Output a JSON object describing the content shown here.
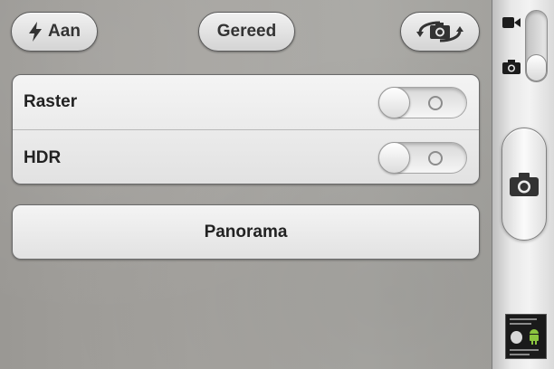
{
  "toolbar": {
    "flash_label": "Aan",
    "done_label": "Gereed"
  },
  "settings": {
    "rows": [
      {
        "label": "Raster",
        "toggle_on": false
      },
      {
        "label": "HDR",
        "toggle_on": false
      }
    ]
  },
  "panorama": {
    "label": "Panorama"
  },
  "control_bar": {
    "mode": "photo"
  },
  "icons": {
    "flash": "lightning-icon",
    "switch_camera": "switch-camera-icon",
    "video": "video-camera-icon",
    "photo": "camera-icon",
    "shutter": "camera-icon"
  },
  "colors": {
    "button_text": "#333333",
    "android_green": "#8cc63f"
  }
}
